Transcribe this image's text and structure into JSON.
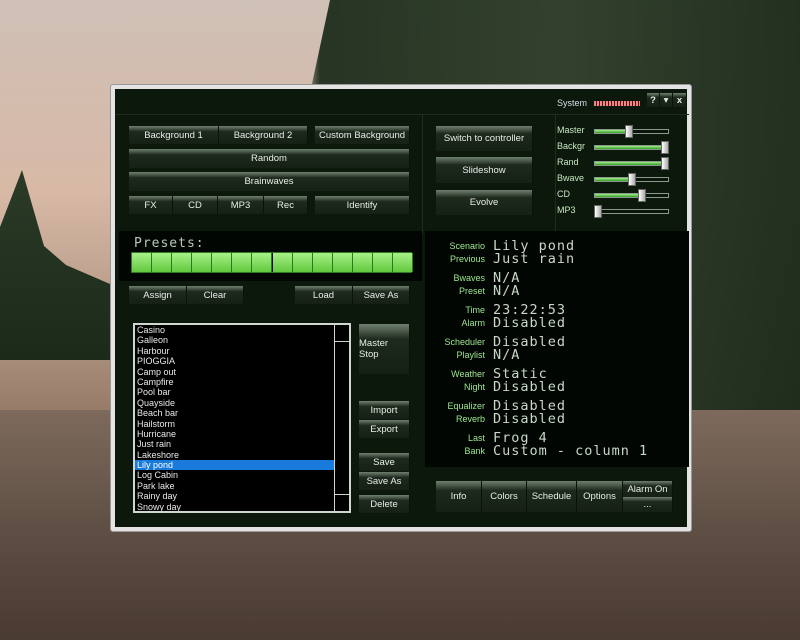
{
  "titlebar": {
    "system_label": "System",
    "help": "?",
    "minimize": "▾",
    "close": "x"
  },
  "scene_buttons": {
    "bg1": "Background 1",
    "bg2": "Background 2",
    "custom": "Custom Background",
    "random": "Random",
    "brainwaves": "Brainwaves",
    "fx": "FX",
    "cd": "CD",
    "mp3": "MP3",
    "rec": "Rec",
    "identify": "Identify"
  },
  "mode_buttons": {
    "switch": "Switch to controller",
    "slideshow": "Slideshow",
    "evolve": "Evolve"
  },
  "sliders": [
    {
      "label": "Master",
      "value": 0.47
    },
    {
      "label": "Backgr",
      "value": 1.0
    },
    {
      "label": "Rand",
      "value": 1.0
    },
    {
      "label": "Bwave",
      "value": 0.5
    },
    {
      "label": "CD",
      "value": 0.65
    },
    {
      "label": "MP3",
      "value": 0.0
    }
  ],
  "presets": {
    "label": "Presets:",
    "slots": 14,
    "assign": "Assign",
    "clear": "Clear",
    "load": "Load",
    "save_as": "Save As"
  },
  "scenarios": {
    "items": [
      "Casino",
      "Galleon",
      "Harbour",
      "PIOGGIA",
      "Camp out",
      "Campfire",
      "Pool bar",
      "Quayside",
      "Beach bar",
      "Hailstorm",
      "Hurricane",
      "Just rain",
      "Lakeshore",
      "Lily pond",
      "Log Cabin",
      "Park lake",
      "Rainy day",
      "Snowy day"
    ],
    "selected": "Lily pond"
  },
  "list_buttons": {
    "master_stop": "Master Stop",
    "import": "Import",
    "export": "Export",
    "save": "Save",
    "save_as": "Save As",
    "delete": "Delete"
  },
  "info": [
    {
      "label": "Scenario",
      "value": "Lily pond"
    },
    {
      "label": "Previous",
      "value": "Just rain"
    },
    {
      "label": "Bwaves",
      "value": "N/A"
    },
    {
      "label": "Preset",
      "value": "N/A"
    },
    {
      "label": "Time",
      "value": "23:22:53"
    },
    {
      "label": "Alarm",
      "value": "Disabled"
    },
    {
      "label": "Scheduler",
      "value": "Disabled"
    },
    {
      "label": "Playlist",
      "value": "N/A"
    },
    {
      "label": "Weather",
      "value": "Static"
    },
    {
      "label": "Night",
      "value": "Disabled"
    },
    {
      "label": "Equalizer",
      "value": "Disabled"
    },
    {
      "label": "Reverb",
      "value": "Disabled"
    },
    {
      "label": "Last",
      "value": "Frog 4"
    },
    {
      "label": "Bank",
      "value": "Custom - column 1"
    }
  ],
  "bottom_buttons": {
    "info": "Info",
    "colors": "Colors",
    "schedule": "Schedule",
    "options": "Options",
    "alarm_on": "Alarm On",
    "more": "..."
  },
  "colors": {
    "accent": "#62c83e",
    "selection": "#1a7adc",
    "background": "#0b180b"
  }
}
